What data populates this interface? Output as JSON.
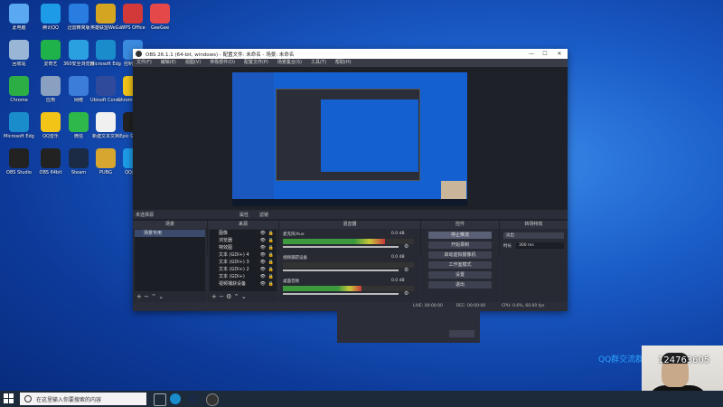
{
  "desktop": {
    "icons": [
      {
        "label": "此电脑",
        "color": "#5aa8f0"
      },
      {
        "label": "腾讯QQ",
        "color": "#1d9be6"
      },
      {
        "label": "迅雷精简版",
        "color": "#2a7de0"
      },
      {
        "label": "英雄联盟WeGame版",
        "color": "#d4a520"
      },
      {
        "label": "WPS Office",
        "color": "#d23a3a"
      },
      {
        "label": "GeeGee",
        "color": "#e54848"
      },
      {
        "label": "回收站",
        "color": "#9ab6d6"
      },
      {
        "label": "爱奇艺",
        "color": "#1fb24a"
      },
      {
        "label": "360安全浏览器",
        "color": "#2aa0e0"
      },
      {
        "label": "Microsoft Edge",
        "color": "#1a8ccc"
      },
      {
        "label": "控制面板",
        "color": "#3a8be0"
      },
      {
        "label": "网易云音乐",
        "color": "#d23030"
      },
      {
        "label": "Chrome",
        "color": "#2cae45"
      },
      {
        "label": "应用",
        "color": "#8aa0c0"
      },
      {
        "label": "网络",
        "color": "#3b7dd8"
      },
      {
        "label": "Ubisoft Connect",
        "color": "#2f4a9a"
      },
      {
        "label": "Chrome浏览器",
        "color": "#f2c418"
      },
      {
        "label": "Windows设置",
        "color": "#888"
      },
      {
        "label": "Microsoft Edge",
        "color": "#1a8ccc"
      },
      {
        "label": "QQ音乐",
        "color": "#f2c418"
      },
      {
        "label": "微信",
        "color": "#2fb84a"
      },
      {
        "label": "新建文本文档",
        "color": "#f0f0f0"
      },
      {
        "label": "Epic Games",
        "color": "#222"
      },
      {
        "label": "NZXT CAM",
        "color": "#6a2ab8"
      },
      {
        "label": "OBS Studio",
        "color": "#222"
      },
      {
        "label": "OBS 64bit",
        "color": "#222"
      },
      {
        "label": "Steam",
        "color": "#1b2a45"
      },
      {
        "label": "PUBG",
        "color": "#d6a630"
      },
      {
        "label": "QQ游戏",
        "color": "#1d9be6"
      },
      {
        "label": "Origin",
        "color": "#f06a20"
      }
    ]
  },
  "taskbar": {
    "search_placeholder": "在这里输入你要搜索的内容"
  },
  "obs": {
    "title": "OBS 26.1.1 (64-bit, windows) - 配置文件: 未命名 - 场景: 未命名",
    "menu": [
      "文件(F)",
      "编辑(E)",
      "视图(V)",
      "停靠部件(D)",
      "配置文件(P)",
      "场景集合(S)",
      "工具(T)",
      "帮助(H)"
    ],
    "scene_label": "未选择源",
    "props_btn": "属性",
    "filters_btn": "滤镜",
    "docks": {
      "scenes": {
        "title": "场景",
        "items": [
          "场景专用"
        ]
      },
      "sources": {
        "title": "来源",
        "items": [
          "图像",
          "浏览器",
          "特效图",
          "文本 (GDI+) 4",
          "文本 (GDI+) 3",
          "文本 (GDI+) 2",
          "文本 (GDI+)",
          "视频捕获设备"
        ]
      },
      "mixer": {
        "title": "混音器",
        "channels": [
          {
            "name": "麦克风/Aux",
            "db": "0.0 dB",
            "level": 0.78
          },
          {
            "name": "视频捕获设备",
            "db": "0.0 dB",
            "level": 0.0
          },
          {
            "name": "桌面音频",
            "db": "0.0 dB",
            "level": 0.6
          }
        ]
      },
      "controls": {
        "title": "控件",
        "buttons": [
          "停止推流",
          "开始录制",
          "启动虚拟摄像机",
          "工作室模式",
          "设置",
          "退出"
        ]
      },
      "transitions": {
        "title": "转场特效",
        "type": "淡出",
        "duration_label": "时长",
        "duration": "300 ms"
      }
    },
    "status": {
      "live": "LIVE: 00:00:00",
      "rec": "REC: 00:00:00",
      "cpu": "CPU: 0.6%, 60.00 fps"
    }
  },
  "overlay": {
    "qq_text": "QQ群交流群",
    "number": "124763605"
  },
  "colors": {
    "accent": "#3b4a6b",
    "desktop": "#1a5cc8"
  }
}
